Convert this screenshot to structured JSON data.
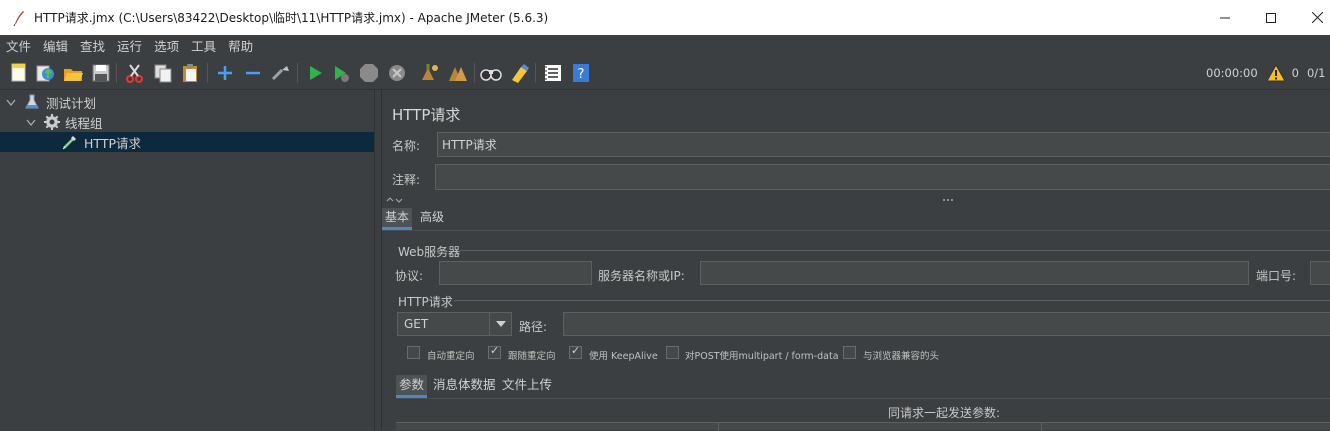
{
  "window": {
    "title": "HTTP请求.jmx (C:\\Users\\83422\\Desktop\\临时\\11\\HTTP请求.jmx) - Apache JMeter (5.6.3)"
  },
  "menu": [
    "文件",
    "编辑",
    "查找",
    "运行",
    "选项",
    "工具",
    "帮助"
  ],
  "toolbar": {
    "icons": [
      "new-icon",
      "templates-icon",
      "open-icon",
      "save-icon",
      "cut-icon",
      "copy-icon",
      "paste-icon",
      "expand-icon",
      "collapse-icon",
      "toggle-icon",
      "start-icon",
      "start-no-pause-icon",
      "stop-icon",
      "shutdown-icon",
      "clear-icon",
      "clear-all-icon",
      "search-icon",
      "reset-search-icon",
      "function-helper-icon",
      "help-icon"
    ],
    "timer": "00:00:00",
    "warning_count": "0",
    "threads": "0/1"
  },
  "tree": {
    "items": [
      {
        "label": "测试计划",
        "icon": "flask-icon"
      },
      {
        "label": "线程组",
        "icon": "gear-icon"
      },
      {
        "label": "HTTP请求",
        "icon": "pipette-icon"
      }
    ]
  },
  "panel": {
    "title": "HTTP请求",
    "name_label": "名称:",
    "name_value": "HTTP请求",
    "comment_label": "注释:",
    "comment_value": "",
    "tabs": [
      "基本",
      "高级"
    ],
    "web_server": {
      "group_title": "Web服务器",
      "protocol_label": "协议:",
      "protocol_value": "",
      "server_label": "服务器名称或IP:",
      "server_value": "",
      "port_label": "端口号:",
      "port_value": ""
    },
    "http_request": {
      "group_title": "HTTP请求",
      "method": "GET",
      "path_label": "路径:",
      "path_value": ""
    },
    "checkboxes": [
      {
        "label": "自动重定向",
        "checked": false
      },
      {
        "label": "跟随重定向",
        "checked": true
      },
      {
        "label": "使用 KeepAlive",
        "checked": true
      },
      {
        "label": "对POST使用multipart / form-data",
        "checked": false
      },
      {
        "label": "与浏览器兼容的头",
        "checked": false
      }
    ],
    "sub_tabs": [
      "参数",
      "消息体数据",
      "文件上传"
    ],
    "params_caption": "同请求一起发送参数:"
  }
}
